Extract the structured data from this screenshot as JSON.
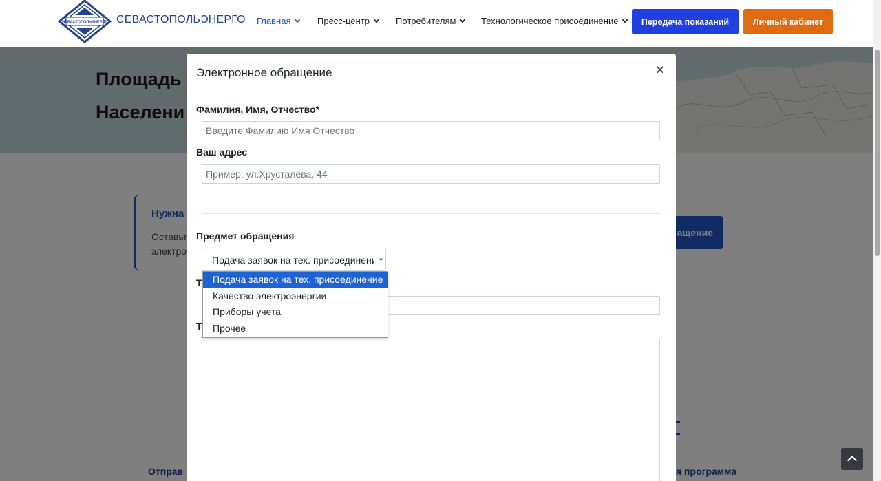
{
  "header": {
    "brand": "СЕВАСТОПОЛЬЭНЕРГО",
    "logo_text": "СЕВАСТОПОЛЬЭНЕРГО",
    "nav": [
      {
        "label": "Главная",
        "active": true
      },
      {
        "label": "Пресс-центр",
        "active": false
      },
      {
        "label": "Потребителям",
        "active": false
      },
      {
        "label": "Технологическое присоединение",
        "active": false
      }
    ],
    "btn_readings": "Передача показаний",
    "btn_cabinet": "Личный кабинет"
  },
  "colors": {
    "brand": "#25448e",
    "accent_blue": "#1f3fdf",
    "accent_orange": "#e06a12",
    "option_highlight": "#1e63d6"
  },
  "background_page": {
    "hero_line1": "Площадь",
    "hero_line2": "Населени",
    "card_title": "Нужна",
    "card_text1": "Оставьт",
    "card_text2": "электро",
    "side_button": "ащение",
    "bottom_left": "Отправ",
    "bottom_right": "я программа"
  },
  "modal": {
    "title": "Электронное обращение",
    "close": "×",
    "fio_label": "Фамилия, Имя, Отчество*",
    "fio_placeholder": "Введите Фамилию Имя Отчество",
    "address_label": "Ваш адрес",
    "address_placeholder": "Пример: ул.Хрусталёва, 44",
    "subject_label": "Предмет обращения",
    "subject_selected": "Подача заявок на тех. присоединение",
    "label_t1": "Т",
    "label_t2": "Т",
    "subject_options": [
      "Подача заявок на тех. присоединение",
      "Качество электроэнергии",
      "Приборы учета",
      "Прочее"
    ]
  },
  "icons": {
    "logo": "sevastopolenergo-logo-icon",
    "nav_chevron": "chevron-down-icon",
    "close": "close-icon",
    "scroll_top": "arrow-up-icon"
  }
}
